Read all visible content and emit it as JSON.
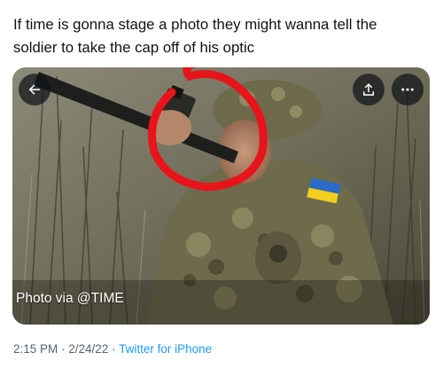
{
  "tweet": {
    "text_line1": "If time is gonna stage a photo they might wanna tell the",
    "text_line2": "soldier to take the cap off of his optic"
  },
  "media": {
    "photo_credit": "Photo via @TIME",
    "back_icon": "arrow-left-icon",
    "share_icon": "share-upload-icon",
    "more_icon": "more-horizontal-icon",
    "annotation_color": "#e8141c"
  },
  "meta": {
    "time": "2:15 PM",
    "separator1": " · ",
    "date": "2/24/22",
    "separator2": " · ",
    "source": "Twitter for iPhone"
  },
  "colors": {
    "text": "#0f1419",
    "secondary": "#536471",
    "link": "#1d9bf0"
  }
}
